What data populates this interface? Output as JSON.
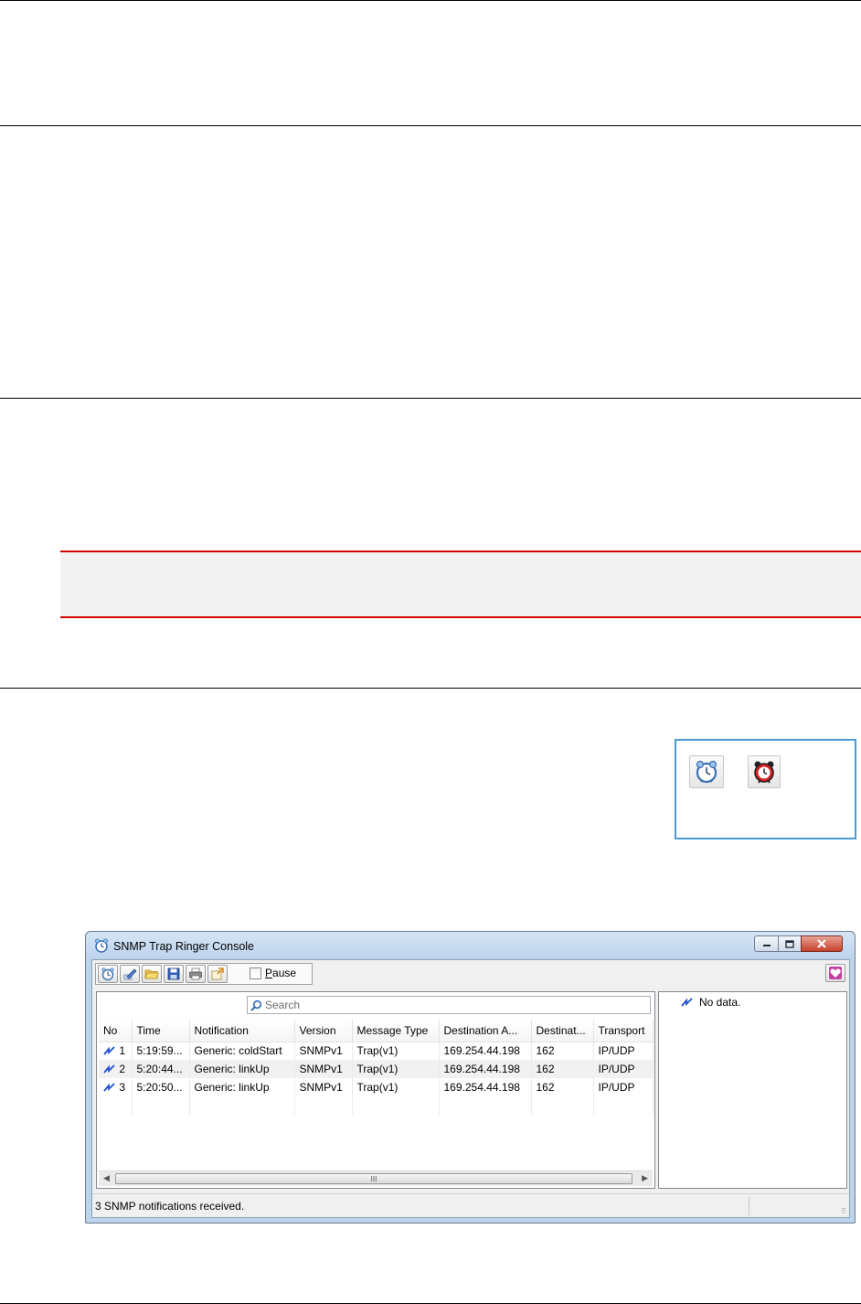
{
  "icons": {
    "ringer_normal": "ringer-clock-icon",
    "ringer_alarm": "alarm-clock-icon"
  },
  "window": {
    "title": "SNMP Trap Ringer Console",
    "toolbar": {
      "buttons": [
        "ringer-clock-icon",
        "edit-icon",
        "open-folder-icon",
        "save-icon",
        "print-icon",
        "export-icon"
      ],
      "pause_label": "Pause",
      "pause_checked": false
    },
    "search_placeholder": "Search",
    "columns": [
      "No",
      "Time",
      "Notification",
      "Version",
      "Message Type",
      "Destination A...",
      "Destinat...",
      "Transport"
    ],
    "rows": [
      {
        "no": "1",
        "time": "5:19:59...",
        "notification": "Generic: coldStart",
        "version": "SNMPv1",
        "message_type": "Trap(v1)",
        "dest_addr": "169.254.44.198",
        "dest_port": "162",
        "transport": "IP/UDP"
      },
      {
        "no": "2",
        "time": "5:20:44...",
        "notification": "Generic: linkUp",
        "version": "SNMPv1",
        "message_type": "Trap(v1)",
        "dest_addr": "169.254.44.198",
        "dest_port": "162",
        "transport": "IP/UDP"
      },
      {
        "no": "3",
        "time": "5:20:50...",
        "notification": "Generic: linkUp",
        "version": "SNMPv1",
        "message_type": "Trap(v1)",
        "dest_addr": "169.254.44.198",
        "dest_port": "162",
        "transport": "IP/UDP"
      }
    ],
    "detail_text": "No data.",
    "status_text": "3 SNMP notifications received."
  },
  "colors": {
    "note_border": "#d40000",
    "callout_border": "#4a9ad4",
    "window_frame": "#bcd3ec",
    "trap_icon": "#1f4fd1"
  }
}
